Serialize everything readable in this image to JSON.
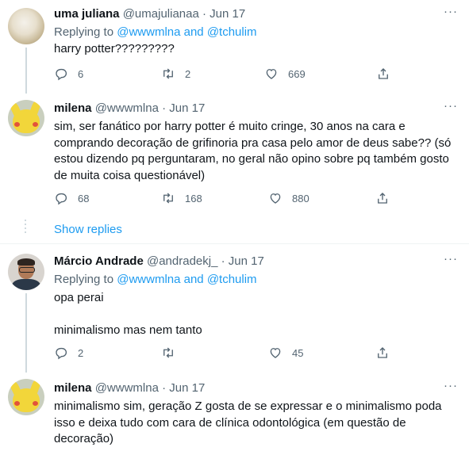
{
  "tweets": [
    {
      "name": "uma juliana",
      "handle": "@umajulianaa",
      "date": "Jun 17",
      "replying_prefix": "Replying to",
      "replying_to": "@wwwmlna and @tchulim",
      "lines": [
        "harry potter?????????"
      ],
      "replies": "6",
      "retweets": "2",
      "likes": "669",
      "avatar": "golden-retriever"
    },
    {
      "name": "milena",
      "handle": "@wwwmlna",
      "date": "Jun 17",
      "lines": [
        "sim, ser fanático por harry potter é muito cringe, 30 anos na cara e",
        "comprando decoração de grifinoria pra casa pelo amor de deus sabe?? (só",
        "estou dizendo pq perguntaram, no geral não opino sobre pq também gosto",
        "de muita coisa questionável)"
      ],
      "replies": "68",
      "retweets": "168",
      "likes": "880",
      "avatar": "pikachu"
    },
    {
      "name": "Márcio Andrade",
      "handle": "@andradekj_",
      "date": "Jun 17",
      "replying_prefix": "Replying to",
      "replying_to": "@wwwmlna and @tchulim",
      "lines": [
        "opa perai",
        "",
        "minimalismo mas nem tanto"
      ],
      "replies": "2",
      "retweets": "",
      "likes": "45",
      "avatar": "person-glasses"
    },
    {
      "name": "milena",
      "handle": "@wwwmlna",
      "date": "Jun 17",
      "lines": [
        "minimalismo sim, geração Z gosta de se expressar e o minimalismo poda",
        "isso e deixa tudo com cara de clínica odontológica (em questão de",
        "decoração)"
      ],
      "avatar": "pikachu"
    }
  ],
  "show_replies": "Show replies",
  "separator": "·",
  "more_icon": "···",
  "colors": {
    "link": "#1d9bf0",
    "muted": "#536471",
    "text": "#0f1419"
  }
}
